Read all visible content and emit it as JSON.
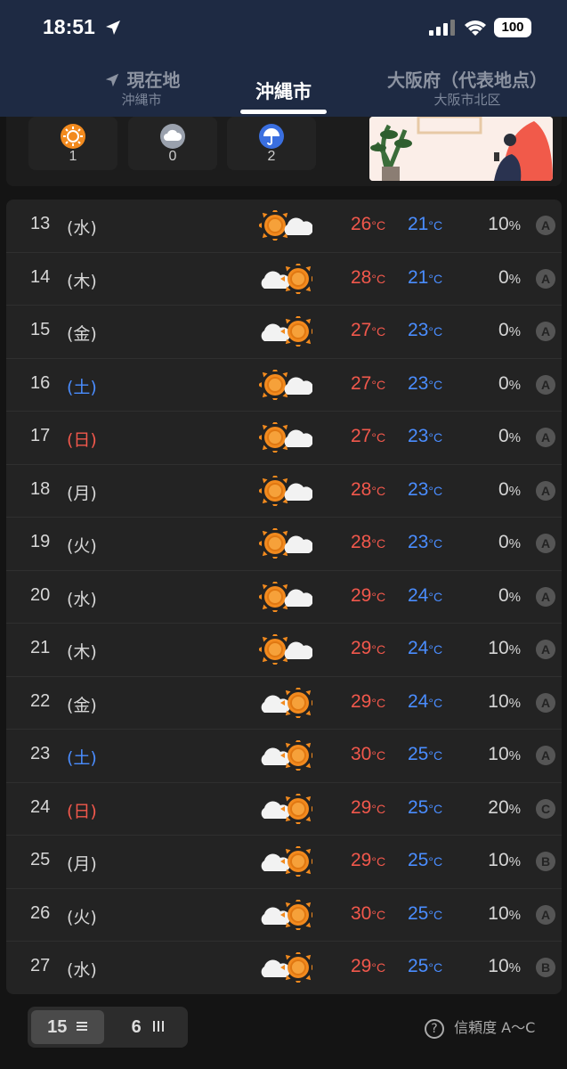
{
  "status_bar": {
    "time": "18:51",
    "battery": "100"
  },
  "tabs": [
    {
      "title": "現在地",
      "subtitle": "沖縄市",
      "active": false
    },
    {
      "title": "沖縄市",
      "subtitle": "",
      "active": true
    },
    {
      "title": "大阪府（代表地点）",
      "subtitle": "大阪市北区",
      "active": false
    }
  ],
  "summary": [
    {
      "icon": "sun-icon",
      "count": "1"
    },
    {
      "icon": "cloud-icon",
      "count": "0"
    },
    {
      "icon": "umbrella-icon",
      "count": "2"
    }
  ],
  "units": {
    "temp": "°C",
    "percent": "%"
  },
  "forecast": [
    {
      "date": "13",
      "dow": "(水)",
      "day_type": "weekday",
      "weather": "sun-cloud",
      "high": "26",
      "low": "21",
      "rain": "10",
      "reliability": "A"
    },
    {
      "date": "14",
      "dow": "(木)",
      "day_type": "weekday",
      "weather": "cloud-sun",
      "high": "28",
      "low": "21",
      "rain": "0",
      "reliability": "A"
    },
    {
      "date": "15",
      "dow": "(金)",
      "day_type": "weekday",
      "weather": "cloud-sun",
      "high": "27",
      "low": "23",
      "rain": "0",
      "reliability": "A"
    },
    {
      "date": "16",
      "dow": "(土)",
      "day_type": "saturday",
      "weather": "sun-cloud",
      "high": "27",
      "low": "23",
      "rain": "0",
      "reliability": "A"
    },
    {
      "date": "17",
      "dow": "(日)",
      "day_type": "sunday",
      "weather": "sun-cloud",
      "high": "27",
      "low": "23",
      "rain": "0",
      "reliability": "A"
    },
    {
      "date": "18",
      "dow": "(月)",
      "day_type": "weekday",
      "weather": "sun-cloud",
      "high": "28",
      "low": "23",
      "rain": "0",
      "reliability": "A"
    },
    {
      "date": "19",
      "dow": "(火)",
      "day_type": "weekday",
      "weather": "sun-cloud",
      "high": "28",
      "low": "23",
      "rain": "0",
      "reliability": "A"
    },
    {
      "date": "20",
      "dow": "(水)",
      "day_type": "weekday",
      "weather": "sun-cloud",
      "high": "29",
      "low": "24",
      "rain": "0",
      "reliability": "A"
    },
    {
      "date": "21",
      "dow": "(木)",
      "day_type": "weekday",
      "weather": "sun-cloud",
      "high": "29",
      "low": "24",
      "rain": "10",
      "reliability": "A"
    },
    {
      "date": "22",
      "dow": "(金)",
      "day_type": "weekday",
      "weather": "cloud-sun",
      "high": "29",
      "low": "24",
      "rain": "10",
      "reliability": "A"
    },
    {
      "date": "23",
      "dow": "(土)",
      "day_type": "saturday",
      "weather": "cloud-sun",
      "high": "30",
      "low": "25",
      "rain": "10",
      "reliability": "A"
    },
    {
      "date": "24",
      "dow": "(日)",
      "day_type": "sunday",
      "weather": "cloud-sun",
      "high": "29",
      "low": "25",
      "rain": "20",
      "reliability": "C"
    },
    {
      "date": "25",
      "dow": "(月)",
      "day_type": "weekday",
      "weather": "cloud-sun",
      "high": "29",
      "low": "25",
      "rain": "10",
      "reliability": "B"
    },
    {
      "date": "26",
      "dow": "(火)",
      "day_type": "weekday",
      "weather": "cloud-sun",
      "high": "30",
      "low": "25",
      "rain": "10",
      "reliability": "A"
    },
    {
      "date": "27",
      "dow": "(水)",
      "day_type": "weekday",
      "weather": "cloud-sun",
      "high": "29",
      "low": "25",
      "rain": "10",
      "reliability": "B"
    }
  ],
  "view_toggle": {
    "option_15": "15",
    "option_6": "6",
    "selected": "15"
  },
  "reliability_label": "信頼度 A〜C",
  "colors": {
    "high": "#f2584c",
    "low": "#4a8dff",
    "header": "#1e2a43",
    "sun": "#f28a1e"
  }
}
